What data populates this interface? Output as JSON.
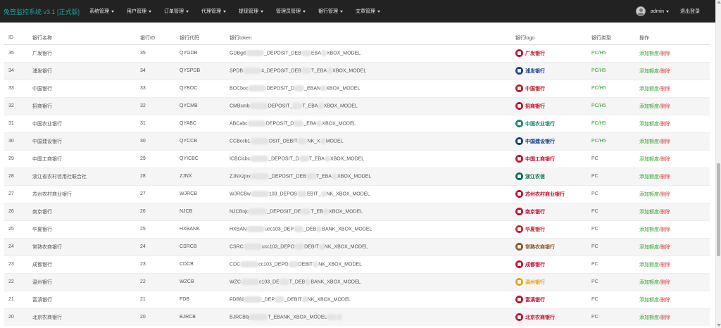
{
  "header": {
    "brand": "免签监控系统 v3.1 [正式版]",
    "menu": [
      {
        "label": "系统管理"
      },
      {
        "label": "用户管理"
      },
      {
        "label": "订单管理"
      },
      {
        "label": "代理管理"
      },
      {
        "label": "提现管理"
      },
      {
        "label": "管理员管理"
      },
      {
        "label": "银行管理"
      },
      {
        "label": "文章管理"
      }
    ],
    "user": "admin",
    "logout": "退出登录"
  },
  "table": {
    "columns": {
      "id": "ID",
      "name": "银行名称",
      "bank_id": "银行ID",
      "code": "银行代码",
      "token": "银行token",
      "logo": "银行logo",
      "type": "银行类型",
      "action": "操作"
    },
    "action_add": "添加额度",
    "action_sep": "/",
    "action_del": "删除",
    "rows": [
      {
        "id": "35",
        "name": "广发银行",
        "bank_id": "35",
        "code": "QYGDB",
        "token_a": "GDBgd",
        "token_b": "_DEPOSIT_DEB",
        "token_c": "EBA",
        "token_d": "XBOX_MODEL",
        "logo_text": "广发银行",
        "logo_color": "#c8102e",
        "type": "PC/H5"
      },
      {
        "id": "34",
        "name": "浦发银行",
        "bank_id": "34",
        "code": "QYSPDB",
        "token_a": "SPDB",
        "token_b": "4_DEPOSIT_DEB",
        "token_c": "T_EBA",
        "token_d": "XBOX_MODEL",
        "logo_text": "浦发银行",
        "logo_color": "#1c3f94",
        "type": "PC/H5"
      },
      {
        "id": "33",
        "name": "中国银行",
        "bank_id": "33",
        "code": "QYBOC",
        "token_a": "BOCboc",
        "token_b": "DEPOSIT_D",
        "token_c": "_EBAN",
        "token_d": "XBOX_MODEL",
        "logo_text": "中国银行",
        "logo_color": "#b81c22",
        "type": "PC/H5"
      },
      {
        "id": "32",
        "name": "招商银行",
        "bank_id": "32",
        "code": "QYCMB",
        "token_a": "CMBcmb",
        "token_b": "DEPOSIT_",
        "token_c": "T_EBA",
        "token_d": "XBOX_MODEL",
        "logo_text": "招商银行",
        "logo_color": "#c8102e",
        "type": "PC/H5"
      },
      {
        "id": "31",
        "name": "中国农业银行",
        "bank_id": "31",
        "code": "QYABC",
        "token_a": "ABCabc",
        "token_b": "DEPOSIT_D",
        "token_c": "_EBA",
        "token_d": "XBOX_MODEL",
        "logo_text": "中国农业银行",
        "logo_color": "#1a8a6e",
        "type": "PC/H5"
      },
      {
        "id": "30",
        "name": "中国建设银行",
        "bank_id": "30",
        "code": "QYCCB",
        "token_a": "CCBccb1",
        "token_b": "OSIT_DEBIT",
        "token_c": "NK_X",
        "token_d": "MODEL",
        "logo_text": "中国建设银行",
        "logo_color": "#0a3e8c",
        "type": "PC/H5"
      },
      {
        "id": "29",
        "name": "中国工商银行",
        "bank_id": "29",
        "code": "QYICBC",
        "token_a": "ICBCicbc",
        "token_b": "_DEPOSIT_D",
        "token_c": "T_EBA",
        "token_d": "XBOX_MODEL",
        "logo_text": "中国工商银行",
        "logo_color": "#c8102e",
        "type": "PC"
      },
      {
        "id": "28",
        "name": "浙江省农村信用社联合社",
        "bank_id": "28",
        "code": "ZJNX",
        "token_a": "ZJNXzjnx",
        "token_b": "_DEPOSIT_DEB",
        "token_c": "T_EBA",
        "token_d": "XBOX_MODEL",
        "logo_text": "浙江农信",
        "logo_color": "#0b6e4f",
        "type": "PC"
      },
      {
        "id": "27",
        "name": "苏州农村商业银行",
        "bank_id": "27",
        "code": "WJRCB",
        "token_a": "WJRCBw",
        "token_b": "103_DEPOS",
        "token_c": "EBIT_",
        "token_d": "NK_XBOX_MODEL",
        "logo_text": "苏州农村商业银行",
        "logo_color": "#c8102e",
        "type": "PC"
      },
      {
        "id": "26",
        "name": "南京银行",
        "bank_id": "26",
        "code": "NJCB",
        "token_a": "NJCBnjc",
        "token_b": "_DEPOSIT_DE",
        "token_c": "T_EB",
        "token_d": "XBOX_MODEL",
        "logo_text": "南京银行",
        "logo_color": "#c8102e",
        "type": "PC"
      },
      {
        "id": "25",
        "name": "华夏银行",
        "bank_id": "25",
        "code": "HXBANK",
        "token_a": "HXBAN",
        "token_b": "ucc103_DEP",
        "token_c": "_DEB",
        "token_d": "BANK_XBOX_MODEL",
        "logo_text": "华夏银行",
        "logo_color": "#d2202f",
        "type": "PC"
      },
      {
        "id": "24",
        "name": "常熟农商银行",
        "bank_id": "24",
        "code": "CSRCB",
        "token_a": "CSRC",
        "token_b": "ucc103_DEPO",
        "token_c": "DEBIT",
        "token_d": "NK_XBOX_MODEL",
        "logo_text": "常熟农商银行",
        "logo_color": "#8a5a2b",
        "type": "PC"
      },
      {
        "id": "23",
        "name": "成都银行",
        "bank_id": "23",
        "code": "CDCB",
        "token_a": "CDC",
        "token_b": "cc103_DEPO",
        "token_c": "DEBIT",
        "token_d": "NK_XBOX_MODEL",
        "logo_text": "成都银行",
        "logo_color": "#c8102e",
        "type": "PC"
      },
      {
        "id": "22",
        "name": "温州银行",
        "bank_id": "22",
        "code": "WZCB",
        "token_a": "WZC",
        "token_b": "c103_DE",
        "token_c": "T_DEB",
        "token_d": "BANK_XBOX_MODEL",
        "logo_text": "温州银行",
        "logo_color": "#e8a317",
        "type": "PC"
      },
      {
        "id": "21",
        "name": "富滇银行",
        "bank_id": "21",
        "code": "FDB",
        "token_a": "FDBfd",
        "token_b": "_DEP",
        "token_c": "_DEBIT",
        "token_d": "NK_XBOX_MODEL",
        "logo_text": "富滇银行",
        "logo_color": "#c8102e",
        "type": "PC"
      },
      {
        "id": "20",
        "name": "北京农商银行",
        "bank_id": "20",
        "code": "BJRCB",
        "token_a": "BJRCBbj",
        "token_b": "T_EBANK_XBOX_MODEL",
        "token_c": "",
        "token_d": "",
        "logo_text": "北京农商银行",
        "logo_color": "#c8102e",
        "type": "PC"
      }
    ]
  }
}
